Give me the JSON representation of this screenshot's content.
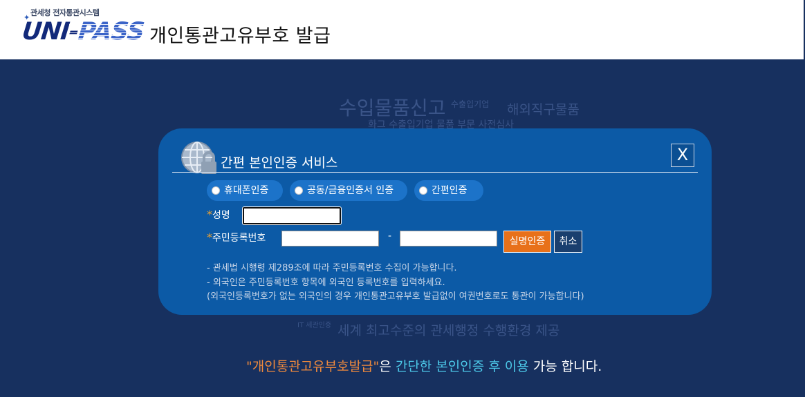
{
  "header": {
    "logo_subtitle": "관세청 전자통관시스템",
    "logo_text_uni": "UNI-",
    "logo_text_pass": "PASS",
    "title": "개인통관고유부호 발급"
  },
  "background_texts": {
    "line1": "수입물품신고",
    "line1_small": "수출입기업",
    "line2": "해외직구물품",
    "line3": "화그 수출입기업 물품 부문 사전심사",
    "line4_small": "IT 세관인증",
    "line5": "세계 최고수준의 관세행정 수행환경 제공"
  },
  "modal": {
    "title": "간편 본인인증 서비스",
    "close_label": "X",
    "auth_options": [
      {
        "label": "휴대폰인증",
        "selected": false
      },
      {
        "label": "공동/금융인증서 인증",
        "selected": false
      },
      {
        "label": "간편인증",
        "selected": false
      }
    ],
    "required_mark": "*",
    "name_label": "성명",
    "name_value": "",
    "rrn_label": "주민등록번호",
    "rrn_front_value": "",
    "rrn_back_value": "",
    "rrn_separator": "-",
    "verify_button": "실명인증",
    "cancel_button": "취소",
    "notes": [
      "- 관세법 시행령 제289조에 따라 주민등록번호 수집이 가능합니다.",
      "- 외국인은 주민등록번호 항목에 외국인 등록번호를 입력하세요.",
      "(외국인등록번호가 없는 외국인의 경우 개인통관고유부호 발급없이 여권번호로도 통관이 가능합니다)"
    ]
  },
  "bottom_message": {
    "quoted": "\"개인통관고유부호발급\"",
    "part1": "은 ",
    "highlight": "간단한 본인인증 후 이용",
    "part2": " 가능 합니다."
  },
  "colors": {
    "background": "#17305f",
    "modal": "#0c5aa6",
    "pill": "#1c73c9",
    "verify_button": "#e8711a",
    "required_mark": "#f0a22e",
    "highlight": "#4cc8e8",
    "quote": "#f08a3c"
  }
}
